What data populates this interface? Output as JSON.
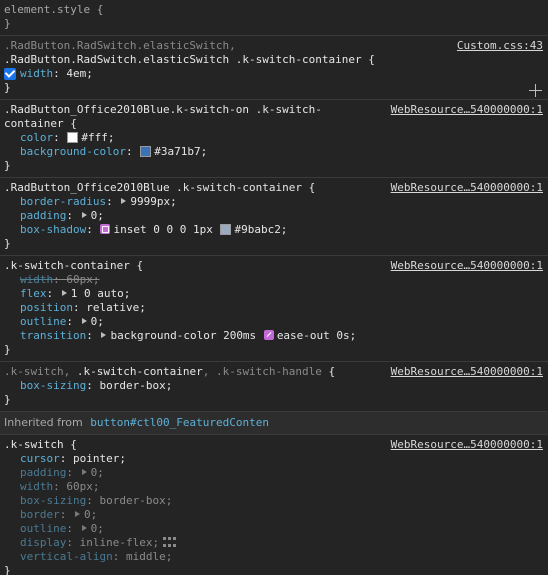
{
  "element_style": {
    "selector": "element.style {",
    "close": "}"
  },
  "rules": [
    {
      "selector_lines": [
        {
          "parts": [
            {
              "text": ".RadButton.RadSwitch.elasticSwitch,",
              "active": false
            }
          ]
        },
        {
          "parts": [
            {
              "text": ".RadButton.RadSwitch.elasticSwitch .k-switch-container",
              "active": true
            },
            {
              "text": " {",
              "active": true
            }
          ]
        }
      ],
      "source": "Custom.css:43",
      "decls": [
        {
          "prop": "width",
          "val": "4em;",
          "checkbox": true
        }
      ],
      "plus": true
    },
    {
      "selector_lines": [
        {
          "parts": [
            {
              "text": ".RadButton_Office2010Blue.k-switch-on .k-switch-",
              "active": true
            }
          ]
        },
        {
          "parts": [
            {
              "text": "container {",
              "active": true
            }
          ]
        }
      ],
      "source": "WebResource…540000000:1",
      "decls": [
        {
          "prop": "color",
          "val": "#fff;",
          "swatch": "#ffffff"
        },
        {
          "prop": "background-color",
          "val": "#3a71b7;",
          "swatch": "#3a71b7"
        }
      ]
    },
    {
      "selector_lines": [
        {
          "parts": [
            {
              "text": ".RadButton_Office2010Blue .k-switch-container {",
              "active": true
            }
          ]
        }
      ],
      "source": "WebResource…540000000:1",
      "decls": [
        {
          "prop": "border-radius",
          "val": "9999px;",
          "tri": true
        },
        {
          "prop": "padding",
          "val": "0;",
          "tri": true
        },
        {
          "prop": "box-shadow",
          "val_pre": "inset 0 0 0 1px",
          "val": "#9babc2;",
          "shadow_icon": true,
          "swatch": "#9babc2"
        }
      ]
    },
    {
      "selector_lines": [
        {
          "parts": [
            {
              "text": ".k-switch-container {",
              "active": true
            }
          ]
        }
      ],
      "source": "WebResource…540000000:1",
      "decls": [
        {
          "prop": "width",
          "val": "60px;",
          "strike": true
        },
        {
          "prop": "flex",
          "val": "1 0 auto;",
          "tri": true
        },
        {
          "prop": "position",
          "val": "relative;"
        },
        {
          "prop": "outline",
          "val": "0;",
          "tri": true
        },
        {
          "prop": "transition",
          "val_pre": "background-color 200ms",
          "val": "ease-out 0s;",
          "tri": true,
          "ease_icon": true
        }
      ]
    },
    {
      "selector_lines": [
        {
          "parts": [
            {
              "text": ".k-switch, ",
              "active": false
            },
            {
              "text": ".k-switch-container",
              "active": true
            },
            {
              "text": ", .k-switch-handle",
              "active": false
            },
            {
              "text": " {",
              "active": true
            }
          ]
        }
      ],
      "source": "WebResource…540000000:1",
      "decls": [
        {
          "prop": "box-sizing",
          "val": "border-box;"
        }
      ]
    }
  ],
  "inherited": {
    "label": "Inherited from",
    "node": "button#ctl00_FeaturedConten"
  },
  "inherited_rule": {
    "selector_lines": [
      {
        "parts": [
          {
            "text": ".k-switch {",
            "active": true
          }
        ]
      }
    ],
    "source": "WebResource…540000000:1",
    "decls": [
      {
        "prop": "cursor",
        "val": "pointer;"
      },
      {
        "prop": "padding",
        "val": "0;",
        "tri": true,
        "dim": true
      },
      {
        "prop": "width",
        "val": "60px;",
        "dim": true
      },
      {
        "prop": "box-sizing",
        "val": "border-box;",
        "dim": true
      },
      {
        "prop": "border",
        "val": "0;",
        "tri": true,
        "dim": true
      },
      {
        "prop": "outline",
        "val": "0;",
        "tri": true,
        "dim": true
      },
      {
        "prop": "display",
        "val": "inline-flex;",
        "dim": true,
        "flex_icon": true
      },
      {
        "prop": "vertical-align",
        "val": "middle;",
        "dim": true
      }
    ]
  },
  "close_brace": "}"
}
